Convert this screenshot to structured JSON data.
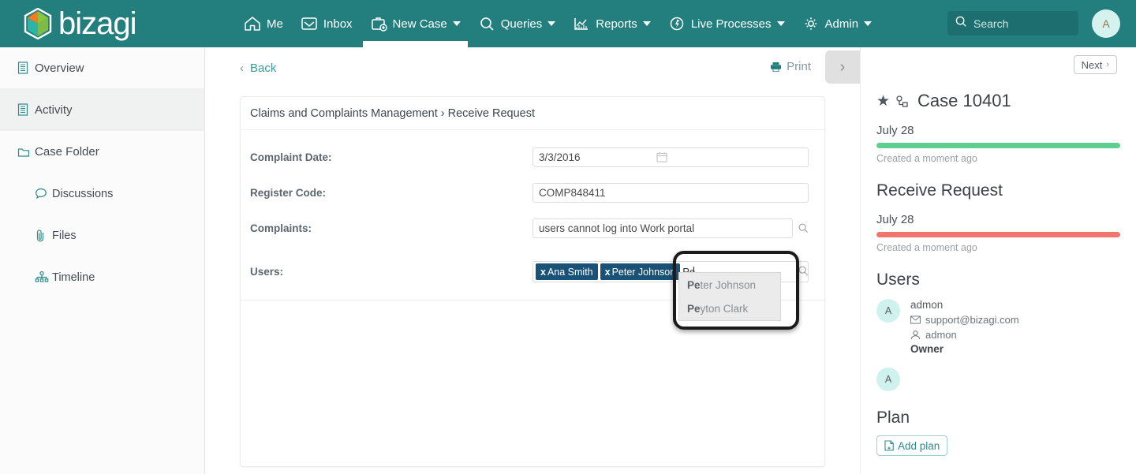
{
  "brand": {
    "name": "bizagi",
    "primary_color": "#237e7e",
    "logo_colors": [
      "#f47b20",
      "#8cc63e",
      "#2bb5a8",
      "#ffffff"
    ]
  },
  "topnav": {
    "items": [
      {
        "label": "Me",
        "icon": "home-icon",
        "caret": false,
        "active": false
      },
      {
        "label": "Inbox",
        "icon": "inbox-icon",
        "caret": false,
        "active": false
      },
      {
        "label": "New Case",
        "icon": "briefcase-plus-icon",
        "caret": true,
        "active": true
      },
      {
        "label": "Queries",
        "icon": "magnifier-icon",
        "caret": true,
        "active": false
      },
      {
        "label": "Reports",
        "icon": "chart-icon",
        "caret": true,
        "active": false
      },
      {
        "label": "Live Processes",
        "icon": "live-processes-icon",
        "caret": true,
        "active": false
      },
      {
        "label": "Admin",
        "icon": "gear-icon",
        "caret": true,
        "active": false
      }
    ],
    "search": {
      "placeholder": "Search",
      "value": ""
    },
    "avatar": {
      "initial": "A"
    }
  },
  "sidebar": {
    "items": [
      {
        "label": "Overview",
        "icon": "document-icon",
        "selected": false,
        "sub": false
      },
      {
        "label": "Activity",
        "icon": "document-icon",
        "selected": true,
        "sub": false
      },
      {
        "label": "Case Folder",
        "icon": "folder-icon",
        "selected": false,
        "sub": false
      },
      {
        "label": "Discussions",
        "icon": "comment-icon",
        "selected": false,
        "sub": true
      },
      {
        "label": "Files",
        "icon": "paperclip-icon",
        "selected": false,
        "sub": true
      },
      {
        "label": "Timeline",
        "icon": "timeline-icon",
        "selected": false,
        "sub": true
      }
    ]
  },
  "toolbar": {
    "back_label": "Back",
    "print_label": "Print",
    "panel_toggle_icon": "chevron-right-icon"
  },
  "form": {
    "breadcrumb_parent": "Claims and Complaints Management",
    "breadcrumb_sep": "›",
    "breadcrumb_current": "Receive Request",
    "fields": [
      {
        "label": "Complaint Date:",
        "value": "3/3/2016",
        "icon": "calendar-icon"
      },
      {
        "label": "Register Code:",
        "value": "COMP848411",
        "icon": ""
      },
      {
        "label": "Complaints:",
        "value": "users cannot log into Work portal",
        "icon": "magnifier-icon"
      }
    ],
    "users_field": {
      "label": "Users:",
      "tokens": [
        {
          "remove": "x",
          "name": "Ana Smith"
        },
        {
          "remove": "x",
          "name": "Peter Johnson"
        }
      ],
      "typed_text": "Pe",
      "icon": "magnifier-icon",
      "token_color": "#1a5176",
      "suggestions": [
        {
          "match": "Pe",
          "rest": "ter Johnson"
        },
        {
          "match": "Pe",
          "rest": "yton Clark"
        }
      ]
    }
  },
  "rightpanel": {
    "next_label": "Next",
    "next_chevron": "›",
    "case_title": "Case 10401",
    "star_icon": "star-icon",
    "share_icon": "share-icon",
    "timeline": [
      {
        "date": "July 28",
        "bar_color": "#5ecf8f",
        "note": "Created a moment ago",
        "heading": ""
      },
      {
        "heading": "Receive Request",
        "date": "July 28",
        "bar_color": "#f1756e",
        "note": "Created a moment ago"
      }
    ],
    "users_heading": "Users",
    "users": [
      {
        "initial": "A",
        "name": "admon",
        "email": "support@bizagi.com",
        "username": "admon",
        "role": "Owner"
      },
      {
        "initial": "A",
        "name": "",
        "email": "",
        "username": "",
        "role": ""
      }
    ],
    "plan_heading": "Plan",
    "add_plan_label": "Add plan"
  }
}
